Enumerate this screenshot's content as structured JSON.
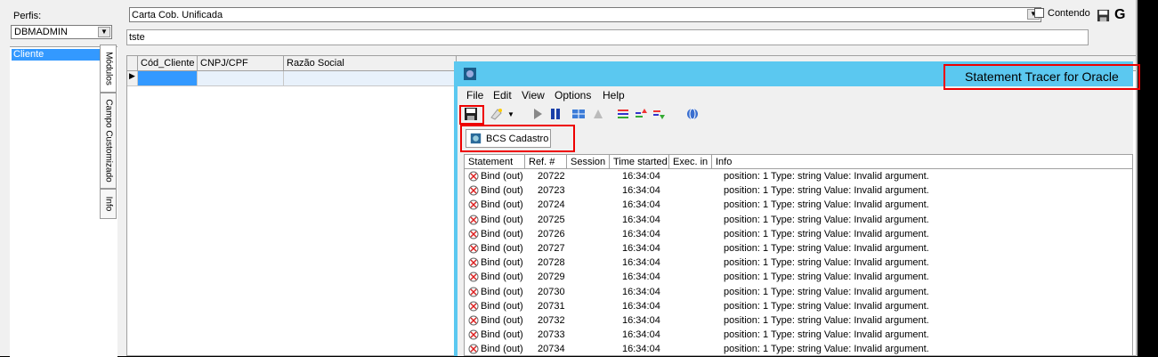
{
  "left_panel": {
    "perfil_label": "Perfis:",
    "perfil_value": "DBMADMIN",
    "modules": [
      "Cliente"
    ],
    "vertical_tabs": [
      "Módulos",
      "Campo Customizado",
      "Info"
    ]
  },
  "main": {
    "report_value": "Carta Cob. Unificada",
    "contendo_label": "Contendo",
    "g_label": "G",
    "search_value": "tste",
    "grid_headers": [
      "Cód_Cliente",
      "CNPJ/CPF",
      "Razão Social"
    ]
  },
  "tracer": {
    "title": "Statement Tracer for Oracle",
    "menu": [
      "File",
      "Edit",
      "View",
      "Options",
      "Help"
    ],
    "tab_label": "BCS Cadastro",
    "columns": [
      "Statement",
      "Ref. #",
      "Session",
      "Time started",
      "Exec. in",
      "Info"
    ],
    "rows": [
      {
        "statement": "Bind (out)",
        "ref": "20722",
        "time": "16:34:04",
        "info": "position: 1 Type: string Value: Invalid argument."
      },
      {
        "statement": "Bind (out)",
        "ref": "20723",
        "time": "16:34:04",
        "info": "position: 1 Type: string Value: Invalid argument."
      },
      {
        "statement": "Bind (out)",
        "ref": "20724",
        "time": "16:34:04",
        "info": "position: 1 Type: string Value: Invalid argument."
      },
      {
        "statement": "Bind (out)",
        "ref": "20725",
        "time": "16:34:04",
        "info": "position: 1 Type: string Value: Invalid argument."
      },
      {
        "statement": "Bind (out)",
        "ref": "20726",
        "time": "16:34:04",
        "info": "position: 1 Type: string Value: Invalid argument."
      },
      {
        "statement": "Bind (out)",
        "ref": "20727",
        "time": "16:34:04",
        "info": "position: 1 Type: string Value: Invalid argument."
      },
      {
        "statement": "Bind (out)",
        "ref": "20728",
        "time": "16:34:04",
        "info": "position: 1 Type: string Value: Invalid argument."
      },
      {
        "statement": "Bind (out)",
        "ref": "20729",
        "time": "16:34:04",
        "info": "position: 1 Type: string Value: Invalid argument."
      },
      {
        "statement": "Bind (out)",
        "ref": "20730",
        "time": "16:34:04",
        "info": "position: 1 Type: string Value: Invalid argument."
      },
      {
        "statement": "Bind (out)",
        "ref": "20731",
        "time": "16:34:04",
        "info": "position: 1 Type: string Value: Invalid argument."
      },
      {
        "statement": "Bind (out)",
        "ref": "20732",
        "time": "16:34:04",
        "info": "position: 1 Type: string Value: Invalid argument."
      },
      {
        "statement": "Bind (out)",
        "ref": "20733",
        "time": "16:34:04",
        "info": "position: 1 Type: string Value: Invalid argument."
      },
      {
        "statement": "Bind (out)",
        "ref": "20734",
        "time": "16:34:04",
        "info": "position: 1 Type: string Value: Invalid argument."
      }
    ]
  },
  "colors": {
    "titlebar": "#5bc8f0",
    "highlight_box": "#e00000",
    "selection": "#3399ff"
  }
}
